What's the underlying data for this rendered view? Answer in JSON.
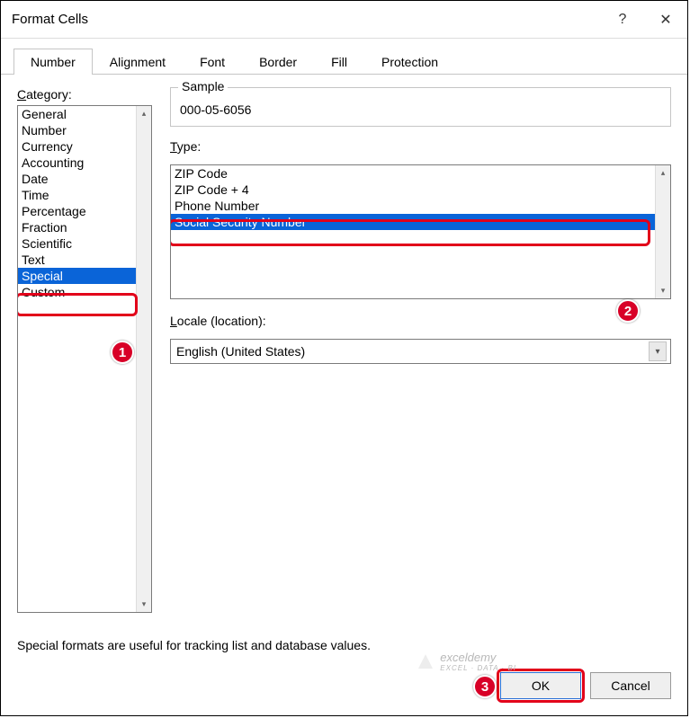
{
  "titlebar": {
    "title": "Format Cells",
    "help": "?",
    "close": "✕"
  },
  "tabs": [
    {
      "label": "Number",
      "active": true
    },
    {
      "label": "Alignment"
    },
    {
      "label": "Font"
    },
    {
      "label": "Border"
    },
    {
      "label": "Fill"
    },
    {
      "label": "Protection"
    }
  ],
  "category": {
    "label": "Category:",
    "items": [
      "General",
      "Number",
      "Currency",
      "Accounting",
      "Date",
      "Time",
      "Percentage",
      "Fraction",
      "Scientific",
      "Text",
      "Special",
      "Custom"
    ],
    "selected": "Special"
  },
  "sample": {
    "legend": "Sample",
    "value": "000-05-6056"
  },
  "type": {
    "label": "Type:",
    "items": [
      "ZIP Code",
      "ZIP Code + 4",
      "Phone Number",
      "Social Security Number"
    ],
    "selected": "Social Security Number"
  },
  "locale": {
    "label": "Locale (location):",
    "value": "English (United States)"
  },
  "description": "Special formats are useful for tracking list and database values.",
  "buttons": {
    "ok": "OK",
    "cancel": "Cancel"
  },
  "callouts": {
    "one": "1",
    "two": "2",
    "three": "3"
  },
  "watermark": {
    "brand": "exceldemy",
    "tag": "EXCEL · DATA · BI"
  }
}
